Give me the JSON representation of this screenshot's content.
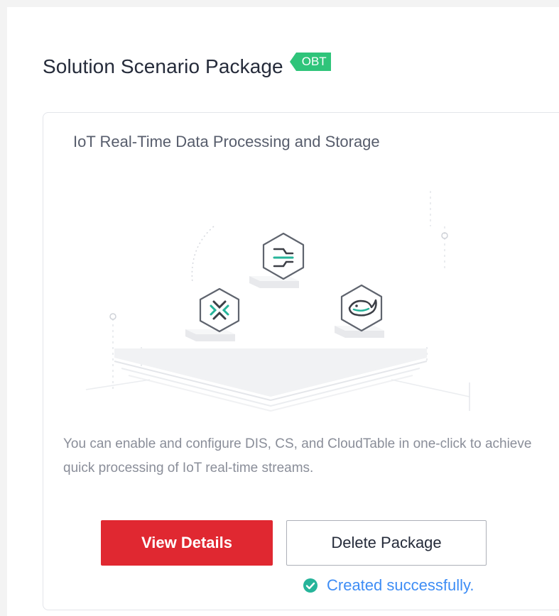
{
  "section": {
    "title": "Solution Scenario Package",
    "badge": "OBT"
  },
  "card": {
    "title": "IoT Real-Time Data Processing and Storage",
    "description": "You can enable and configure DIS, CS, and CloudTable in one-click to achieve quick processing of IoT real-time streams.",
    "illustration_icons": [
      "dis-stream-icon",
      "cloudtable-icon",
      "cs-compute-icon"
    ],
    "actions": {
      "view_details_label": "View Details",
      "delete_package_label": "Delete Package"
    },
    "status": {
      "text": "Created successfully.",
      "icon": "check-circle-icon"
    }
  },
  "colors": {
    "primary_red": "#e02831",
    "badge_green": "#2fc47a",
    "success_green": "#26b49a",
    "link_blue": "#3e8df5",
    "title_text": "#252b3a",
    "body_text": "#8a8e99"
  }
}
